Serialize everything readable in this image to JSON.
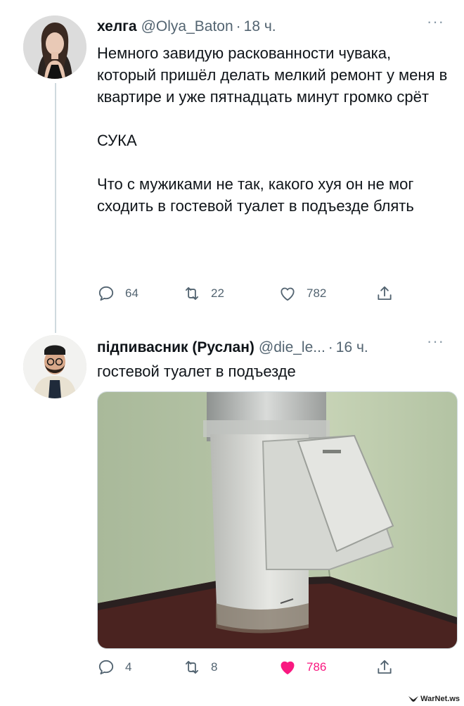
{
  "tweets": [
    {
      "name": "хелга",
      "handle": "@Olya_Baton",
      "time": "18 ч.",
      "lines": [
        "Немного завидую раскованности чувака, который пришёл делать мелкий ремонт у меня в квартире и уже пятнадцать минут громко срёт",
        "СУКА",
        "Что с мужиками не так, какого хуя он не мог сходить в гостевой туалет в подъезде блять"
      ],
      "replies": "64",
      "retweets": "22",
      "likes": "782"
    },
    {
      "name": "підпивасник (Руслан)",
      "handle": "@die_le...",
      "time": "16 ч.",
      "lines": [
        "гостевой туалет в подъезде"
      ],
      "replies": "4",
      "retweets": "8",
      "likes": "786",
      "liked": true
    }
  ],
  "ui": {
    "more": "···",
    "dot": "·"
  },
  "colors": {
    "text": "#0f1419",
    "muted": "#536471",
    "like_active": "#f91880",
    "thread_line": "#cfd9de"
  },
  "icons": [
    "reply-icon",
    "retweet-icon",
    "like-icon",
    "share-icon",
    "more-icon"
  ],
  "watermark": "WarNet.ws"
}
